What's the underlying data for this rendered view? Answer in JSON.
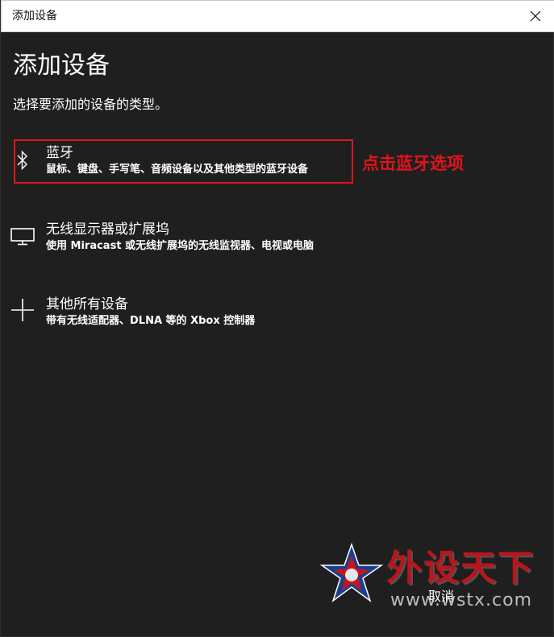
{
  "window": {
    "title": "添加设备",
    "close_icon": "close-icon"
  },
  "main": {
    "title": "添加设备",
    "subtitle": "选择要添加的设备的类型。",
    "options": [
      {
        "icon": "bluetooth-icon",
        "label": "蓝牙",
        "description": "鼠标、键盘、手写笔、音频设备以及其他类型的蓝牙设备"
      },
      {
        "icon": "monitor-icon",
        "label": "无线显示器或扩展坞",
        "description": "使用 Miracast 或无线扩展坞的无线监视器、电视或电脑"
      },
      {
        "icon": "plus-icon",
        "label": "其他所有设备",
        "description": "带有无线适配器、DLNA 等的 Xbox 控制器"
      }
    ],
    "cancel_label": "取消"
  },
  "annotation": {
    "text": "点击蓝牙选项",
    "color": "#e0141b"
  },
  "watermark": {
    "brand": "外设天下",
    "url": "www.wstx.com",
    "logo_icon": "star-logo-icon"
  }
}
